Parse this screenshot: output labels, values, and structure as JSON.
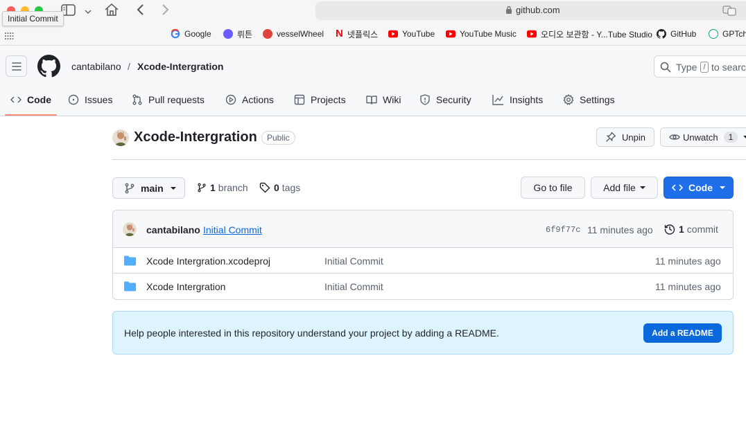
{
  "browser": {
    "tooltip": "Initial Commit",
    "url": "github.com",
    "bookmarks": [
      {
        "label": "Google",
        "icon": "google-icon",
        "color": "#4285f4"
      },
      {
        "label": "뤼튼",
        "icon": "wrtn-icon",
        "color": "#6b5cff"
      },
      {
        "label": "vesselWheel",
        "icon": "vesselwheel-icon",
        "color": "#e0433b"
      },
      {
        "label": "넷플릭스",
        "icon": "netflix-icon",
        "color": "#e50914"
      },
      {
        "label": "YouTube",
        "icon": "youtube-icon",
        "color": "#ff0000"
      },
      {
        "label": "YouTube Music",
        "icon": "youtube-icon",
        "color": "#ff0000"
      },
      {
        "label": "오디오 보관함 - Y...Tube Studio",
        "icon": "youtube-icon",
        "color": "#ff0000"
      },
      {
        "label": "GitHub",
        "icon": "github-icon",
        "color": "#1f2328"
      },
      {
        "label": "GPTch",
        "icon": "chatgpt-icon",
        "color": "#10a37f"
      }
    ]
  },
  "header": {
    "owner": "cantabilano",
    "separator": "/",
    "repo": "Xcode-Intergration",
    "search_text_pre": "Type",
    "search_key": "/",
    "search_text_post": "to searc"
  },
  "nav": [
    {
      "label": "Code",
      "icon": "code-icon",
      "active": true
    },
    {
      "label": "Issues",
      "icon": "issue-icon"
    },
    {
      "label": "Pull requests",
      "icon": "pull-request-icon"
    },
    {
      "label": "Actions",
      "icon": "play-icon"
    },
    {
      "label": "Projects",
      "icon": "table-icon"
    },
    {
      "label": "Wiki",
      "icon": "book-icon"
    },
    {
      "label": "Security",
      "icon": "shield-icon"
    },
    {
      "label": "Insights",
      "icon": "graph-icon"
    },
    {
      "label": "Settings",
      "icon": "gear-icon"
    }
  ],
  "repo": {
    "title": "Xcode-Intergration",
    "visibility": "Public",
    "unpin_label": "Unpin",
    "unwatch_label": "Unwatch",
    "watch_count": "1"
  },
  "toolbar": {
    "branch_name": "main",
    "branch_count": "1",
    "branch_label": "branch",
    "tag_count": "0",
    "tag_label": "tags",
    "goto_file": "Go to file",
    "add_file": "Add file",
    "code": "Code"
  },
  "commit": {
    "author": "cantabilano",
    "message": "Initial Commit",
    "sha": "6f9f77c",
    "time": "11 minutes ago",
    "count": "1",
    "count_label": "commit"
  },
  "files": [
    {
      "name": "Xcode Intergration.xcodeproj",
      "message": "Initial Commit",
      "time": "11 minutes ago",
      "icon": "folder-icon"
    },
    {
      "name": "Xcode Intergration",
      "message": "Initial Commit",
      "time": "11 minutes ago",
      "icon": "folder-icon"
    }
  ],
  "readme": {
    "text": "Help people interested in this repository understand your project by adding a README.",
    "button": "Add a README"
  },
  "colors": {
    "accent": "#0969da",
    "tab_underline": "#fd8c73",
    "folder": "#54aeff",
    "readme_bg": "#ddf4ff"
  }
}
